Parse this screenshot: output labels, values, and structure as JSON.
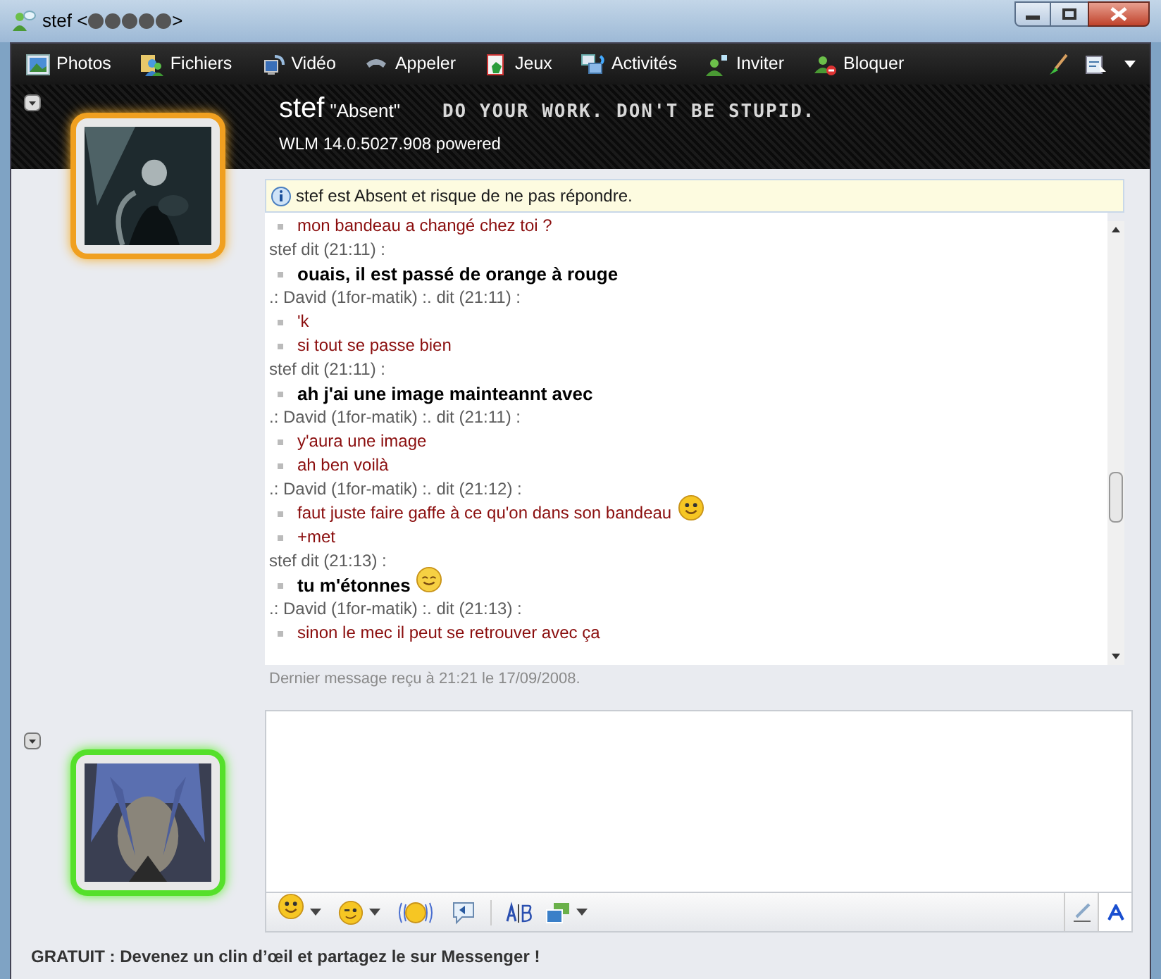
{
  "window": {
    "title": "stef <",
    "title_end": ">"
  },
  "toolbar": {
    "items": [
      {
        "label": "Photos",
        "kind": "photos"
      },
      {
        "label": "Fichiers",
        "kind": "files"
      },
      {
        "label": "Vidéo",
        "kind": "video"
      },
      {
        "label": "Appeler",
        "kind": "call"
      },
      {
        "label": "Jeux",
        "kind": "games"
      },
      {
        "label": "Activités",
        "kind": "activities"
      },
      {
        "label": "Inviter",
        "kind": "invite"
      },
      {
        "label": "Bloquer",
        "kind": "block"
      }
    ]
  },
  "contact": {
    "name": "stef",
    "status": "\"Absent\"",
    "message": "DO YOUR WORK. DON'T BE STUPID.",
    "client": "WLM 14.0.5027.908 powered"
  },
  "notice": "stef est Absent et risque de ne pas répondre.",
  "conversation": [
    {
      "kind": "other",
      "lines": [
        {
          "text": "mon bandeau a changé chez toi ?",
          "kind": "plain"
        }
      ]
    },
    {
      "kind": "own",
      "header": "stef dit (21:11) :",
      "lines": [
        {
          "text": "ouais, il est passé de orange à rouge",
          "kind": "plain"
        }
      ]
    },
    {
      "kind": "other",
      "header": ".: David (1for-matik) :. dit (21:11) :",
      "lines": [
        {
          "text": "'k",
          "kind": "plain"
        },
        {
          "text": "si tout se passe bien",
          "kind": "plain"
        }
      ]
    },
    {
      "kind": "own",
      "header": "stef dit (21:11) :",
      "lines": [
        {
          "text": "ah j'ai une image mainteannt avec",
          "kind": "plain"
        }
      ]
    },
    {
      "kind": "other",
      "header": ".: David (1for-matik) :. dit (21:11) :",
      "lines": [
        {
          "text": "y'aura une image",
          "kind": "plain"
        },
        {
          "text": "ah ben voilà",
          "kind": "plain"
        }
      ]
    },
    {
      "kind": "other",
      "header": ".: David (1for-matik) :. dit (21:12) :",
      "lines": [
        {
          "text": "faut juste faire gaffe à ce qu'on dans son bandeau",
          "kind": "smile"
        },
        {
          "text": "+met",
          "kind": "plain"
        }
      ]
    },
    {
      "kind": "own",
      "header": "stef dit (21:13) :",
      "lines": [
        {
          "text": "tu m'étonnes",
          "kind": "blush"
        }
      ]
    },
    {
      "kind": "other",
      "header": ".: David (1for-matik) :. dit (21:13) :",
      "lines": [
        {
          "text": "sinon le mec il peut se retrouver avec ça",
          "kind": "plain"
        }
      ]
    }
  ],
  "last_message": "Dernier message reçu à 21:21 le 17/09/2008.",
  "footer": {
    "bold": "GRATUIT :",
    "text": "Devenez un clin d’œil et partagez le sur Messenger !"
  }
}
